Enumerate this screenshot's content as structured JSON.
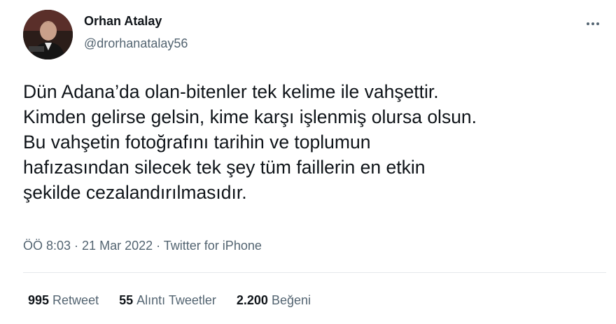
{
  "author": {
    "name": "Orhan Atalay",
    "handle": "@drorhanatalay56"
  },
  "tweet": {
    "text": "Dün Adana’da olan-bitenler tek kelime ile vahşettir.\nKimden gelirse gelsin, kime karşı işlenmiş olursa olsun.\nBu vahşetin fotoğrafını tarihin ve toplumun\nhafızasından silecek tek şey tüm faillerin en etkin\nşekilde cezalandırılmasıdır."
  },
  "meta": {
    "time": "ÖÖ 8:03",
    "separator": " · ",
    "date": "21 Mar 2022",
    "source": "Twitter for iPhone"
  },
  "stats": {
    "retweets_count": "995",
    "retweets_label": "Retweet",
    "quotes_count": "55",
    "quotes_label": "Alıntı Tweetler",
    "likes_count": "2.200",
    "likes_label": "Beğeni"
  },
  "icons": {
    "more": "more-dots-icon"
  },
  "colors": {
    "text_primary": "#0f1419",
    "text_secondary": "#536471",
    "divider": "#e4e8eb"
  }
}
